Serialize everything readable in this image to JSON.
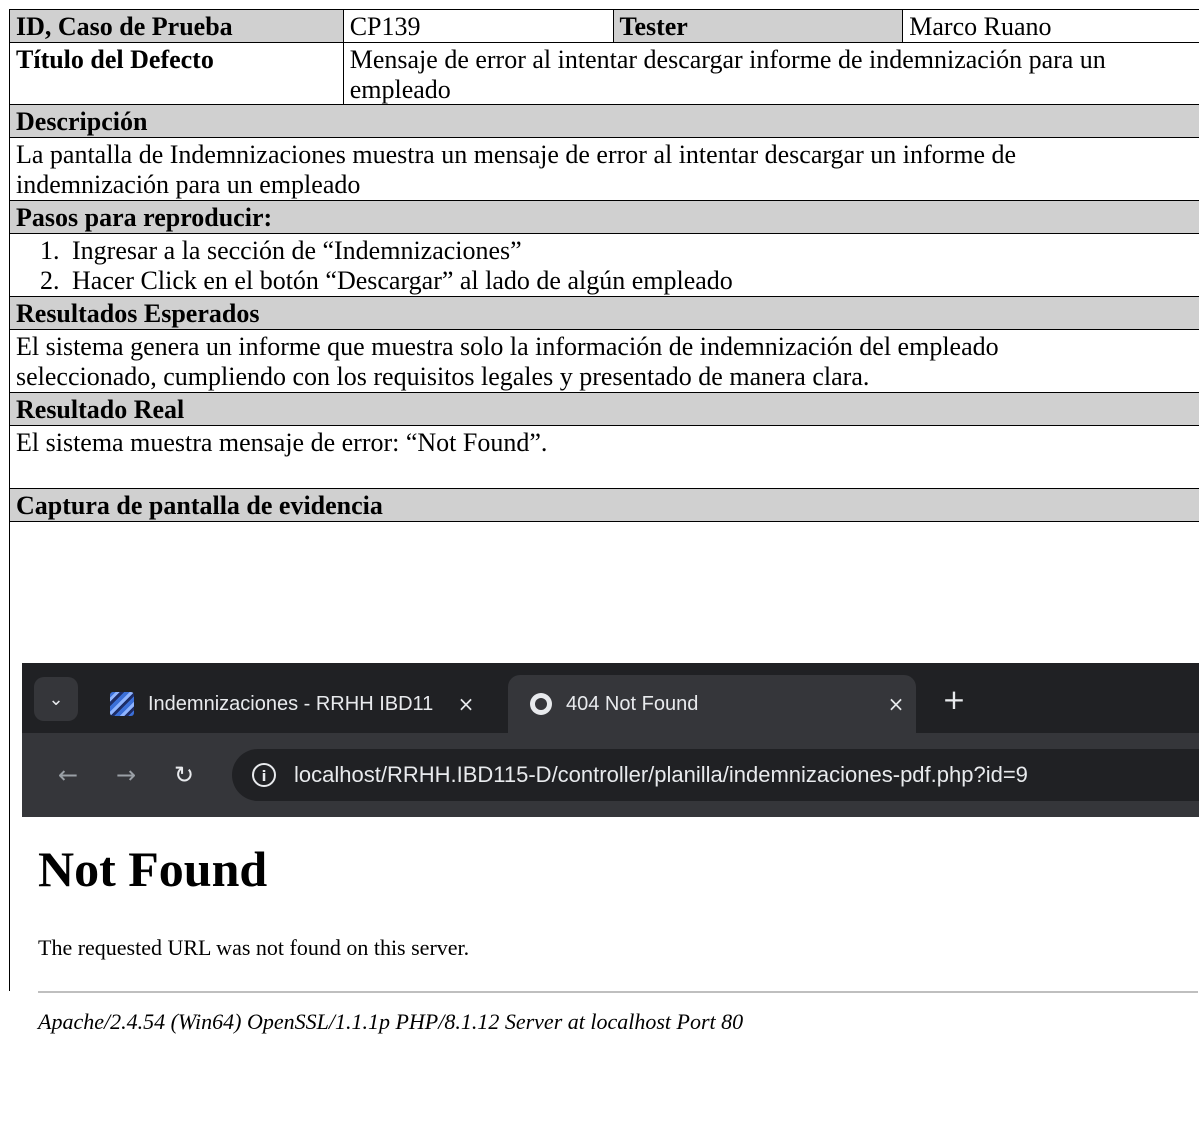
{
  "header_row": {
    "id_label": "ID, Caso de Prueba",
    "id_value": "CP139",
    "tester_label": "Tester",
    "tester_value": "Marco Ruano"
  },
  "title_row": {
    "label": "Título del Defecto",
    "value": "Mensaje de error al intentar descargar informe de indemnización para un empleado"
  },
  "description": {
    "label": "Descripción",
    "text": "La pantalla de Indemnizaciones muestra un mensaje de error al intentar descargar un informe de indemnización para un empleado"
  },
  "steps": {
    "label": "Pasos para reproducir:",
    "items": [
      "Ingresar a la sección de “Indemnizaciones”",
      "Hacer Click en el botón “Descargar” al lado de algún empleado"
    ]
  },
  "expected": {
    "label": "Resultados Esperados",
    "text": "El sistema genera un informe que muestra solo la información de indemnización del empleado seleccionado, cumpliendo con los requisitos legales y presentado de manera clara."
  },
  "actual": {
    "label": "Resultado Real",
    "text": "El sistema muestra mensaje de error: “Not Found”."
  },
  "evidence": {
    "label": "Captura de pantalla de evidencia",
    "browser": {
      "tab1_title": "Indemnizaciones - RRHH IBD11",
      "tab2_title": "404 Not Found",
      "close_glyph": "×",
      "new_tab_glyph": "+",
      "url": "localhost/RRHH.IBD115-D/controller/planilla/indemnizaciones-pdf.php?id=9"
    },
    "page": {
      "heading": "Not Found",
      "message": "The requested URL was not found on this server.",
      "server_signature": "Apache/2.4.54 (Win64) OpenSSL/1.1.1p PHP/8.1.12 Server at localhost Port 80"
    }
  }
}
